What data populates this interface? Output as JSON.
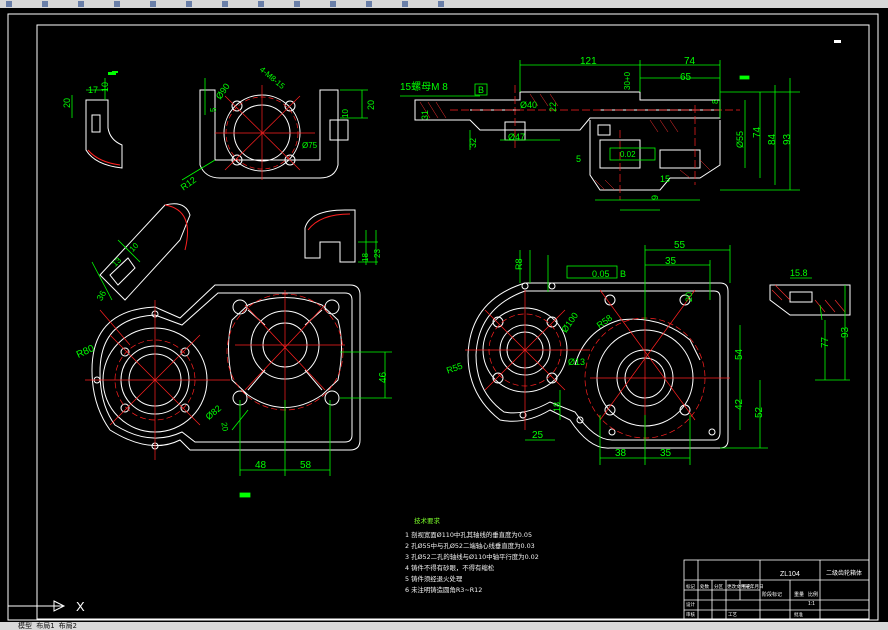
{
  "colors": {
    "background": "#000000",
    "geometry": "#ffffff",
    "dimension": "#00ff00",
    "center": "#ff2020",
    "hatch": "#ff3030",
    "frame": "#ffffff"
  },
  "toolbar": {
    "icons": [
      "file-icon",
      "open-icon",
      "save-icon",
      "undo-icon",
      "redo-icon",
      "cut-icon",
      "copy-icon",
      "paste-icon",
      "match-icon",
      "pan-icon",
      "zoom-icon",
      "layers-icon",
      "properties-icon"
    ]
  },
  "dims": {
    "d20a": "20",
    "d17": "17",
    "d10a": "10",
    "d90": "Ø90",
    "d4holes": "4-M8-15",
    "d5a": "5",
    "d10b": "10",
    "d20b": "20",
    "d75": "Ø75",
    "r12": "R12",
    "d13": "13",
    "d10c": "10",
    "d36": "36",
    "d15c": "15",
    "d18": "18",
    "d23": "23",
    "thread": "15螺母M 8",
    "datum_b": "B",
    "d40": "Ø40",
    "d31": "31",
    "d22": "22",
    "d32": "32",
    "d47": "Ø47",
    "d121": "121",
    "d74a": "74",
    "d65": "65",
    "d30": "30+0",
    "d8": "8",
    "d65b": "Ø55",
    "d74b": "74",
    "d84": "84",
    "d93": "93",
    "d5b": "5",
    "tol1": "0.02",
    "d15b": "15",
    "d9": "9",
    "r80": "R80",
    "d82": "Ø82",
    "d20c": "20",
    "d48": "48",
    "d58": "58",
    "d46": "46",
    "r8": "R8",
    "tol2": "0.05",
    "datum_b2": "B",
    "d55": "55",
    "d35": "35",
    "d20d": "20",
    "d100": "Ø100",
    "d13b": "Ø13",
    "r58": "R58",
    "r55": "R55",
    "d25": "25",
    "d18b": "18",
    "d38": "38",
    "d35b": "35",
    "d54": "54",
    "d42": "42",
    "d52": "52",
    "d15_8": "15.8",
    "d77": "77",
    "d93b": "93"
  },
  "notes": {
    "title": "技术要求",
    "items": [
      "1 剖视宽面Ø110中孔其轴线的垂直度为0.05",
      "2 孔Ø55中与孔Ø52二端轴心线垂直度为0.03",
      "3 孔Ø52二孔的轴线与Ø110中轴平行度为0.02",
      "4 铸件不得有砂眼，不得有缩松",
      "5 铸件须经退火处理",
      "6 未注明铸造圆角R3~R12"
    ]
  },
  "title_block": {
    "drawing_no": "ZL104",
    "part_name": "二级齿轮箱体",
    "scale": "1:1",
    "c1": "标记",
    "c2": "处数",
    "c3": "分区",
    "c4": "更改文件号",
    "c5": "签名",
    "c6": "年月日",
    "design": "设计",
    "check": "审核",
    "process": "工艺",
    "approve": "批准",
    "stage": "阶段标记",
    "weight": "重量",
    "ratio": "比例"
  },
  "ucs": {
    "label": "X"
  },
  "statusbar": {
    "text": "模型  布局1  布局2"
  }
}
